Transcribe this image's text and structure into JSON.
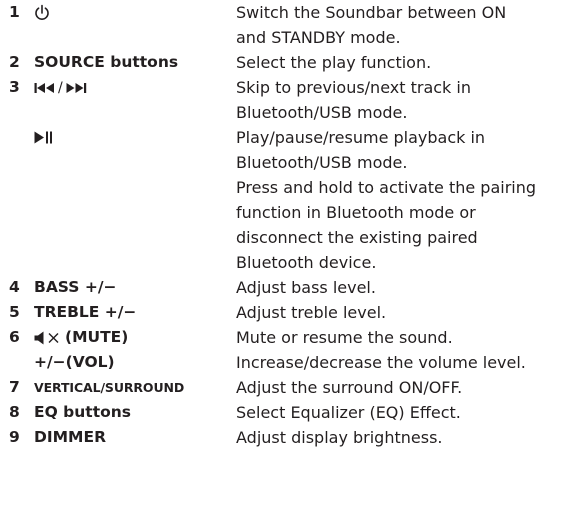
{
  "rows": [
    {
      "num": "1",
      "item": "",
      "icon": "power-icon",
      "desc": "Switch the Soundbar between ON\nand STANDBY mode."
    },
    {
      "num": "2",
      "item": "SOURCE buttons",
      "desc": "Select the play function."
    },
    {
      "num": "3",
      "item": "/",
      "icon": "skip-previous-next-icons",
      "desc": "Skip to previous/next track in\nBluetooth/USB mode."
    },
    {
      "num": "",
      "item": "",
      "icon": "play-pause-icon",
      "desc": "Play/pause/resume playback in\nBluetooth/USB mode.\nPress and hold to activate the pairing\nfunction in Bluetooth mode or\ndisconnect the existing paired\nBluetooth device."
    },
    {
      "num": "4",
      "item": "BASS +/−",
      "desc": "Adjust bass level."
    },
    {
      "num": "5",
      "item": "TREBLE +/−",
      "desc": "Adjust treble level."
    },
    {
      "num": "6",
      "item": "(MUTE)",
      "icon": "mute-icon",
      "desc": "Mute or resume the sound."
    },
    {
      "num": "",
      "item": "+/−(VOL)",
      "desc": "Increase/decrease the volume level."
    },
    {
      "num": "7",
      "item": "VERTICAL/SURROUND",
      "desc": "Adjust the surround ON/OFF."
    },
    {
      "num": "8",
      "item": "EQ buttons",
      "desc": "Select Equalizer (EQ) Effect."
    },
    {
      "num": "9",
      "item": "DIMMER",
      "desc": "Adjust display brightness."
    }
  ]
}
